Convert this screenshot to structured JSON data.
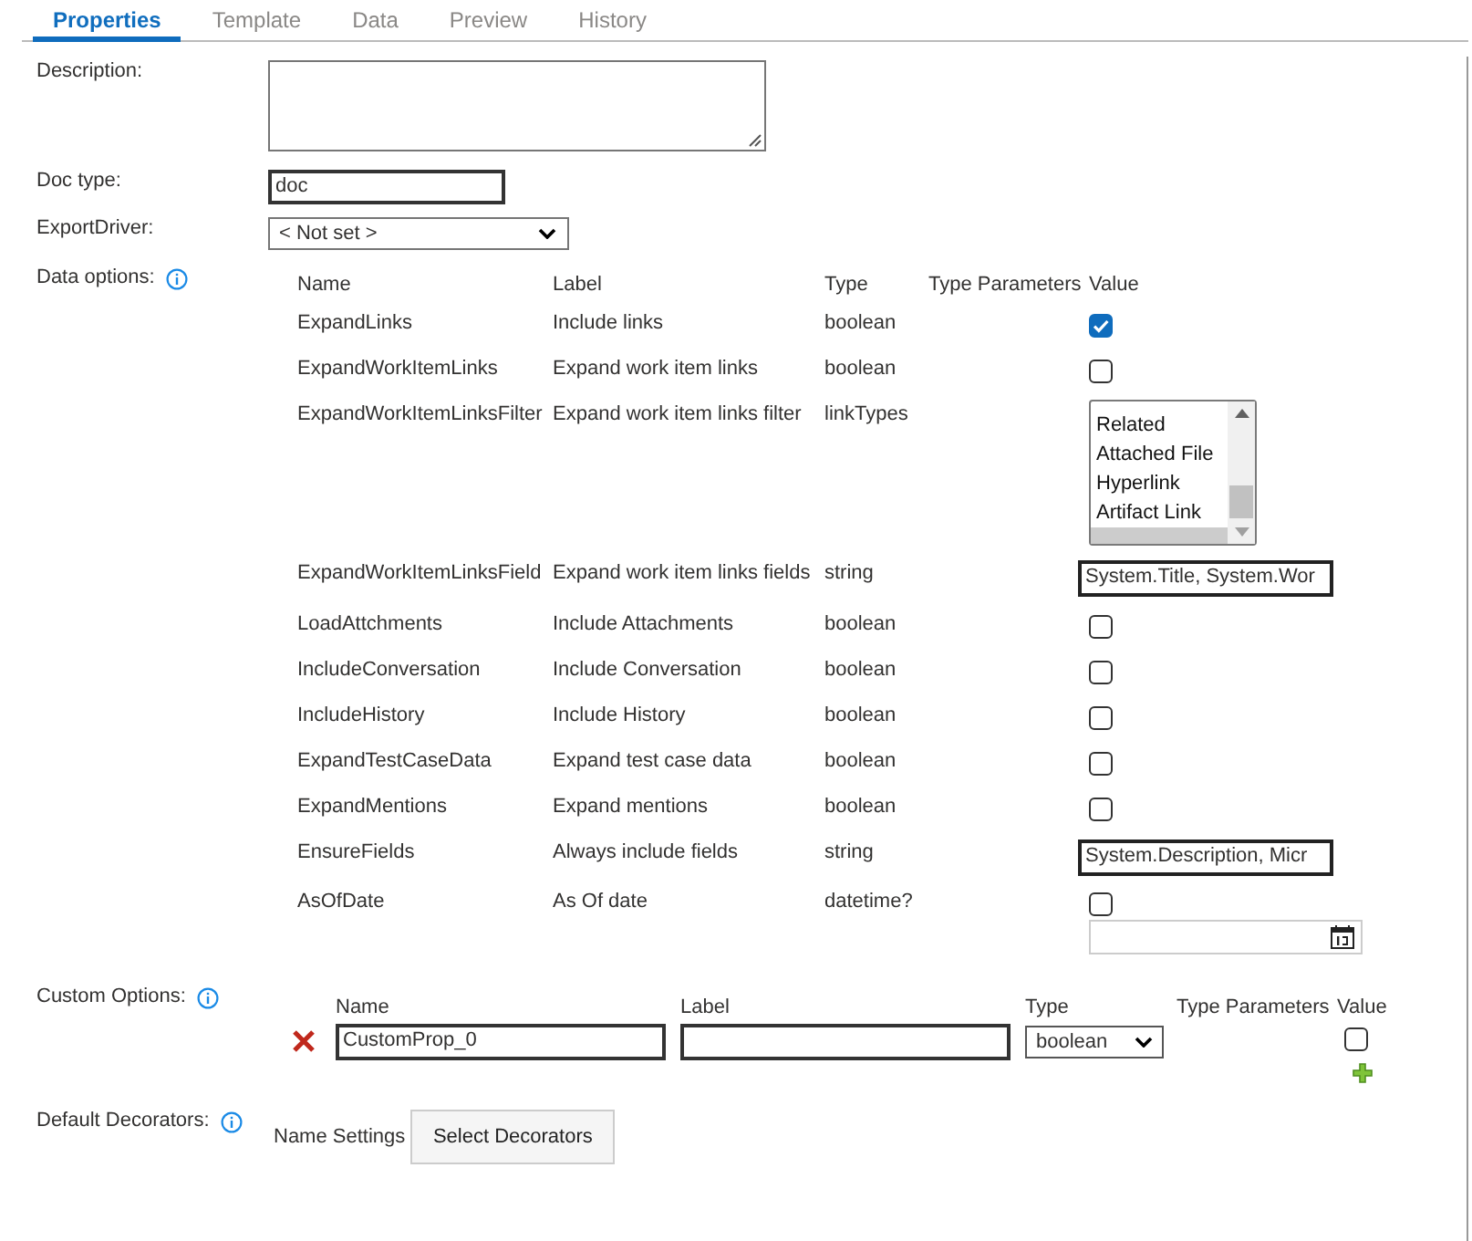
{
  "tabs": [
    {
      "label": "Properties",
      "selected": true
    },
    {
      "label": "Template",
      "selected": false
    },
    {
      "label": "Data",
      "selected": false
    },
    {
      "label": "Preview",
      "selected": false
    },
    {
      "label": "History",
      "selected": false
    }
  ],
  "description": {
    "label": "Description:"
  },
  "doc_type": {
    "label": "Doc type:",
    "value": "doc"
  },
  "export_driver": {
    "label": "ExportDriver:",
    "value": "< Not set >"
  },
  "data_options": {
    "label": "Data options:",
    "columns": [
      "Name",
      "Label",
      "Type",
      "Type Parameters",
      "Value"
    ],
    "rows": [
      {
        "name": "ExpandLinks",
        "label": "Include links",
        "type": "boolean",
        "kind": "checkbox",
        "checked": true
      },
      {
        "name": "ExpandWorkItemLinks",
        "label": "Expand work item links",
        "type": "boolean",
        "kind": "checkbox",
        "checked": false
      },
      {
        "name": "ExpandWorkItemLinksFilter",
        "label": "Expand work item links filter",
        "type": "linkTypes",
        "kind": "listbox",
        "items": [
          "Related",
          "Attached File",
          "Hyperlink",
          "Artifact Link"
        ]
      },
      {
        "name": "ExpandWorkItemLinksField",
        "label": "Expand work item links fields",
        "type": "string",
        "kind": "text",
        "value": "System.Title, System.Wor"
      },
      {
        "name": "LoadAttchments",
        "label": "Include Attachments",
        "type": "boolean",
        "kind": "checkbox",
        "checked": false
      },
      {
        "name": "IncludeConversation",
        "label": "Include Conversation",
        "type": "boolean",
        "kind": "checkbox",
        "checked": false
      },
      {
        "name": "IncludeHistory",
        "label": "Include History",
        "type": "boolean",
        "kind": "checkbox",
        "checked": false
      },
      {
        "name": "ExpandTestCaseData",
        "label": "Expand test case data",
        "type": "boolean",
        "kind": "checkbox",
        "checked": false
      },
      {
        "name": "ExpandMentions",
        "label": "Expand mentions",
        "type": "boolean",
        "kind": "checkbox",
        "checked": false
      },
      {
        "name": "EnsureFields",
        "label": "Always include fields",
        "type": "string",
        "kind": "text",
        "value": "System.Description, Micr"
      },
      {
        "name": "AsOfDate",
        "label": "As Of date",
        "type": "datetime?",
        "kind": "date",
        "checked": false
      }
    ]
  },
  "custom_options": {
    "label": "Custom Options:",
    "columns": [
      "Name",
      "Label",
      "Type",
      "Type Parameters",
      "Value"
    ],
    "rows": [
      {
        "name": "CustomProp_0",
        "type": "boolean",
        "checked": false
      }
    ]
  },
  "default_decorators": {
    "label": "Default Decorators:",
    "caption": "Name Settings",
    "button": "Select Decorators"
  }
}
